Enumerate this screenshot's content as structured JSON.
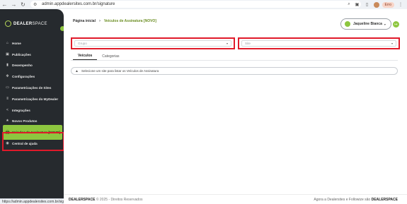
{
  "browser": {
    "url": "admin.appdealersites.com.br/signature",
    "error_label": "Erro",
    "status_url": "https://admin.appdealersites.com.br/signature"
  },
  "sidebar": {
    "logo_bold": "DEALER",
    "logo_light": "SPACE",
    "items": [
      {
        "label": "Home",
        "icon": "home-icon"
      },
      {
        "label": "Publicações",
        "icon": "publications-icon"
      },
      {
        "label": "Desempenho",
        "icon": "bar-chart-icon"
      },
      {
        "label": "Configurações",
        "icon": "gear-icon"
      },
      {
        "label": "Parametrizações de Sites",
        "icon": "monitor-icon"
      },
      {
        "label": "Parametrizações do MyDealer",
        "icon": "sliders-icon"
      },
      {
        "label": "Integrações",
        "icon": "share-icon"
      },
      {
        "label": "Novos Produtos",
        "icon": "star-icon"
      },
      {
        "label": "Veículos de Assinatura [NOVO]",
        "icon": "car-icon"
      },
      {
        "label": "Central de ajuda",
        "icon": "help-icon"
      }
    ]
  },
  "header": {
    "breadcrumb_home": "Página inicial",
    "breadcrumb_current": "Veículos de Assinatura [NOVO]",
    "user_name": "Jaqueline Bianca"
  },
  "filters": {
    "group_placeholder": "Grupo",
    "site_placeholder": "Site"
  },
  "tabs": [
    "Veículos",
    "Categorias"
  ],
  "alert_text": "Selecione um site para listar os Veículos de Assinatura",
  "footer": {
    "brand": "DEALERSPACE",
    "copyright": "© 2025 - Direitos Reservados",
    "right_text": "Agora a Dealersites e Followize são",
    "right_brand": "DEALERSPACE"
  }
}
